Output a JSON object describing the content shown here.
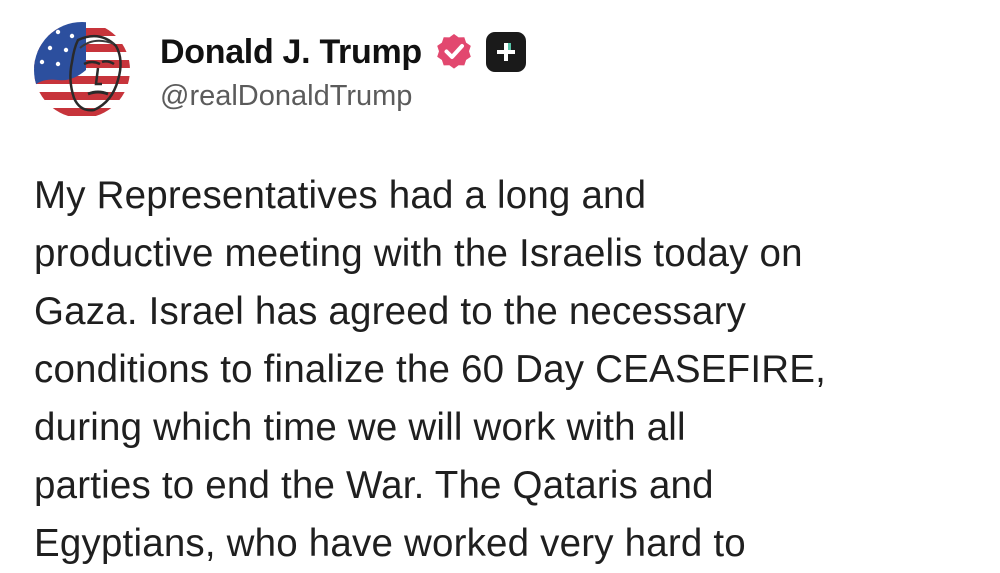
{
  "author": {
    "display_name": "Donald J. Trump",
    "handle": "@realDonaldTrump",
    "avatar_icon": "flag-face-avatar",
    "verified_icon": "verified-badge-icon",
    "verified_color": "#e2486f",
    "plus_icon": "plus-badge-icon"
  },
  "post": {
    "text": "My Representatives had a long and\nproductive meeting with the Israelis today on\nGaza. Israel has agreed to the necessary\nconditions to finalize the 60 Day CEASEFIRE,\nduring which time we will work with all\nparties to end the War. The Qataris and\nEgyptians, who have worked very hard to"
  }
}
